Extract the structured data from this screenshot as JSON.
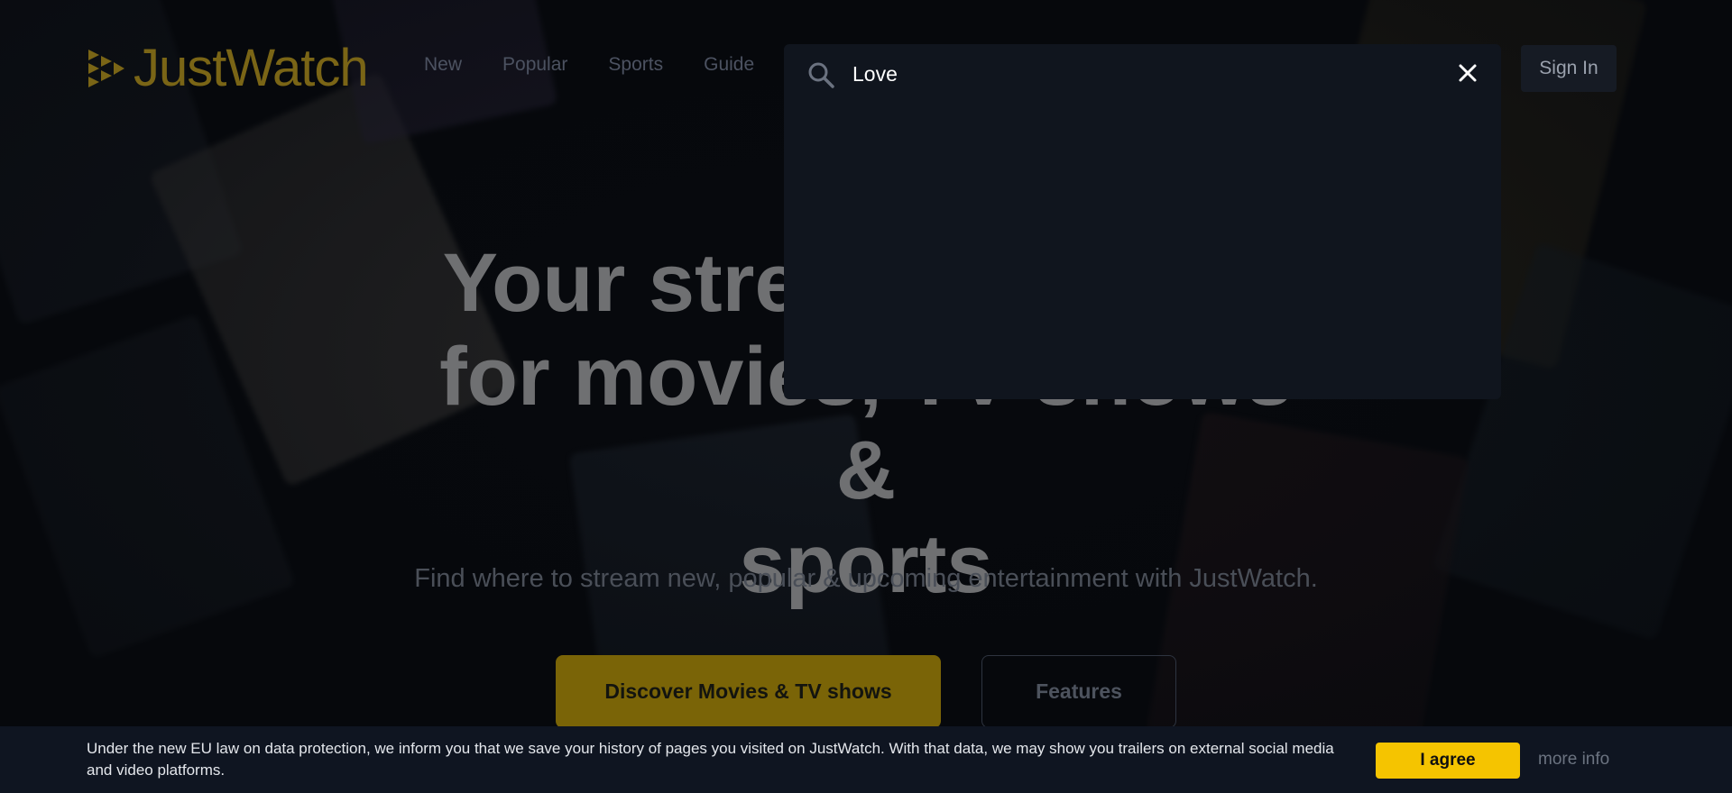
{
  "header": {
    "logo_text": "JustWatch",
    "nav": [
      "New",
      "Popular",
      "Sports",
      "Guide"
    ],
    "sign_in": "Sign In"
  },
  "search": {
    "value": "Love",
    "icons": {
      "search": "search-icon",
      "close": "close-icon"
    }
  },
  "hero": {
    "title_line1": "Your streaming guide",
    "title_line2": "for movies, TV shows &",
    "title_line3": "sports",
    "subtitle": "Find where to stream new, popular & upcoming entertainment with JustWatch.",
    "discover_label": "Discover Movies & TV shows",
    "features_label": "Features"
  },
  "cookie": {
    "text": "Under the new EU law on data protection, we inform you that we save your history of pages you visited on JustWatch. With that data, we may show you trailers on external social media and video platforms.",
    "agree_label": "I agree",
    "more_info_label": "more info"
  },
  "colors": {
    "accent_yellow": "#f5c400",
    "logo_gold": "#7a6516",
    "panel_bg": "#10151e",
    "cookie_bg": "#0f1521"
  }
}
